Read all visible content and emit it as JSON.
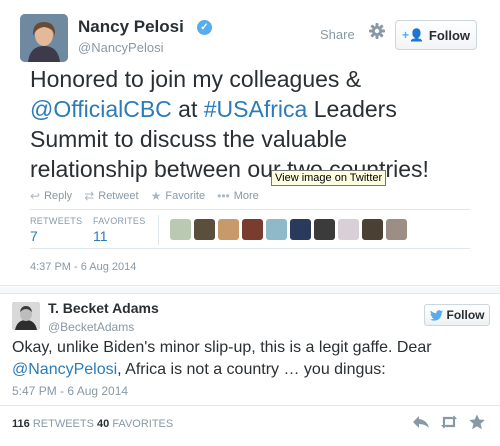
{
  "tweet": {
    "name": "Nancy Pelosi",
    "verified_mark": "✓",
    "handle": "@NancyPelosi",
    "share_label": "Share",
    "follow_label": "Follow",
    "text_before": "Honored to join my colleagues & ",
    "mention": "@OfficialCBC",
    "text_mid": " at ",
    "hashtag": "#USAfrica",
    "text_after": " Leaders Summit to discuss the valuable relationship between our two countries!",
    "actions": {
      "reply": "Reply",
      "retweet": "Retweet",
      "favorite": "Favorite",
      "more": "More"
    },
    "tooltip": "View image on Twitter",
    "stats": {
      "retweets_label": "RETWEETS",
      "retweets": "7",
      "favorites_label": "FAVORITES",
      "favorites": "11"
    },
    "timestamp": "4:37 PM - 6 Aug 2014"
  },
  "quote": {
    "name": "T. Becket Adams",
    "handle": "@BecketAdams",
    "follow_label": "Follow",
    "text_before": "Okay, unlike Biden's minor slip-up, this is a legit gaffe. Dear ",
    "mention": "@NancyPelosi",
    "text_after": ", Africa is not a country … you dingus:",
    "timestamp": "5:47 PM - 6 Aug 2014",
    "retweets": "116",
    "retweets_label": "RETWEETS",
    "favorites": "40",
    "favorites_label": "FAVORITES"
  },
  "colors": {
    "link": "#2b7bb9",
    "muted": "#8899a6",
    "brand": "#55acee"
  }
}
